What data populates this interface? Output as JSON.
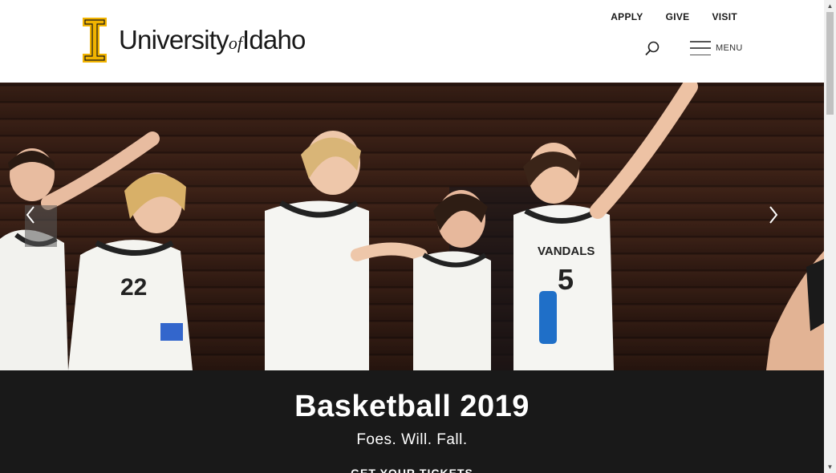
{
  "header": {
    "logo_main": "University",
    "logo_of": "of",
    "logo_end": "Idaho",
    "logo_colors": {
      "gold": "#F1B300",
      "black": "#191919"
    },
    "top_links": [
      "APPLY",
      "GIVE",
      "VISIT"
    ],
    "search_icon": "search-icon",
    "menu_label": "MENU"
  },
  "hero": {
    "prev_icon": "chevron-left-icon",
    "next_icon": "chevron-right-icon"
  },
  "banner": {
    "title": "Basketball 2019",
    "subtitle": "Foes. Will. Fall.",
    "cta": "GET YOUR TICKETS"
  },
  "colors": {
    "banner_bg": "#191919",
    "brand_gold": "#F1B300"
  }
}
